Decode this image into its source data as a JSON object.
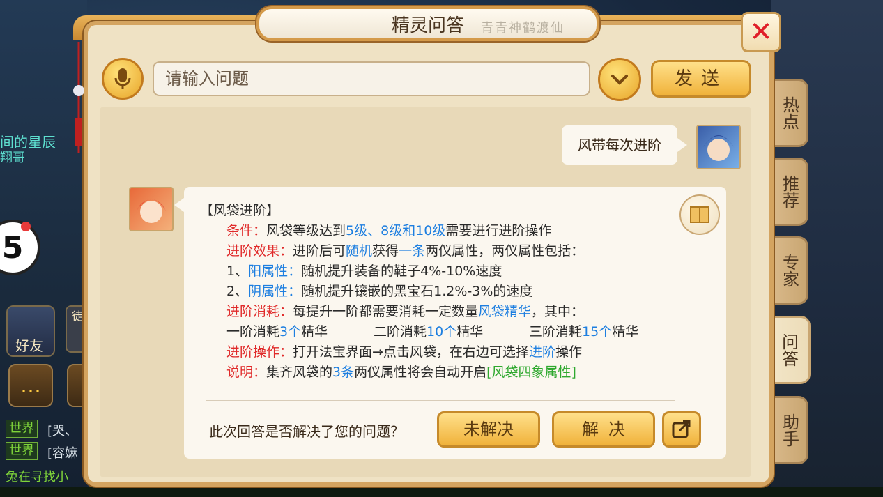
{
  "dialog": {
    "title": "精灵问答",
    "title_deco": "青青神鹤渡仙",
    "close_label": "✕"
  },
  "input": {
    "placeholder": "请输入问题",
    "send_label": "发送"
  },
  "side_tabs": [
    {
      "label": "热点",
      "active": false
    },
    {
      "label": "推荐",
      "active": false
    },
    {
      "label": "专家",
      "active": false
    },
    {
      "label": "问答",
      "active": true
    },
    {
      "label": "助手",
      "active": false
    }
  ],
  "question": "风带每次进阶",
  "answer": {
    "heading": "【风袋进阶】",
    "lines": [
      {
        "l": "条件：",
        "t": "风袋等级达到",
        "h1": "5级、8级和10级",
        "t2": "需要进行进阶操作"
      },
      {
        "l": "进阶效果：",
        "t": "进阶后可",
        "h1": "随机",
        "t2": "获得",
        "h2": "一条",
        "t3": "两仪属性，两仪属性包括："
      },
      {
        "p": "1、",
        "h1": "阳属性：",
        "t": "随机提升装备的鞋子4%-10%速度"
      },
      {
        "p": "2、",
        "h1": "阴属性：",
        "t": "随机提升镶嵌的黑宝石1.2%-3%的速度"
      },
      {
        "l": "进阶消耗：",
        "t": "每提升一阶都需要消耗一定数量",
        "h1": "风袋精华",
        "t2": "，其中："
      },
      {
        "a": "一阶消耗",
        "b": "3个",
        "c": "精华",
        "d": "二阶消耗",
        "e": "10个",
        "f": "精华",
        "g": "三阶消耗",
        "h": "15个",
        "i": "精华"
      },
      {
        "l": "进阶操作：",
        "t": "打开法宝界面→点击风袋，在右边可选择",
        "h1": "进阶",
        "t2": "操作"
      },
      {
        "l": "说明：",
        "t": "集齐风袋的",
        "h1": "3条",
        "t2": "两仪属性将会自动开启",
        "g1": "[风袋四象属性]"
      }
    ]
  },
  "feedback": {
    "question": "此次回答是否解决了您的问题？",
    "unsolved_label": "未解决",
    "solved_label": "解决"
  },
  "hud": {
    "text1": "间的星辰",
    "text2": "翔哥",
    "badge": "5",
    "friend_label": "好友",
    "apprentice_label": "徒",
    "world_label": "世界",
    "world_msg1": "[哭、",
    "world_msg2": "[容嫲",
    "bottom_text": "兔在寻找小"
  },
  "colors": {
    "highlight_red": "#e02a2a",
    "highlight_blue": "#1e7fe0",
    "highlight_green": "#2ea82e",
    "button_gold": "#f0b23a"
  }
}
